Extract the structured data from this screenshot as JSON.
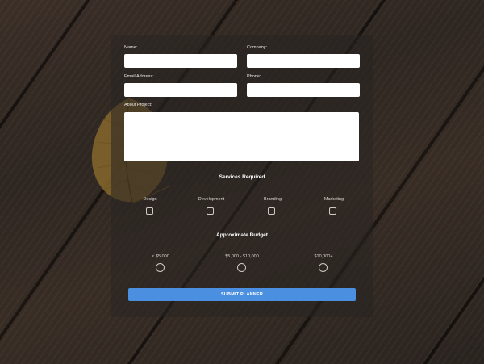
{
  "form": {
    "name_label": "Name:",
    "company_label": "Company:",
    "email_label": "Email Address:",
    "phone_label": "Phone:",
    "about_label": "About Project:",
    "name_value": "",
    "company_value": "",
    "email_value": "",
    "phone_value": "",
    "about_value": ""
  },
  "services": {
    "title": "Services Required",
    "options": [
      {
        "label": "Design",
        "checked": false
      },
      {
        "label": "Development",
        "checked": false
      },
      {
        "label": "Branding",
        "checked": false
      },
      {
        "label": "Marketing",
        "checked": false
      }
    ]
  },
  "budget": {
    "title": "Approximate Budget",
    "options": [
      {
        "label": "< $5,000",
        "selected": false
      },
      {
        "label": "$5,000 - $10,000",
        "selected": false
      },
      {
        "label": "$10,000+",
        "selected": false
      }
    ]
  },
  "submit_label": "SUBMIT PLANNER",
  "colors": {
    "submit": "#4a8fe0",
    "panel": "rgba(40,36,34,0.55)",
    "wood": "#2f2722",
    "leaf": "#8a6a2e"
  }
}
